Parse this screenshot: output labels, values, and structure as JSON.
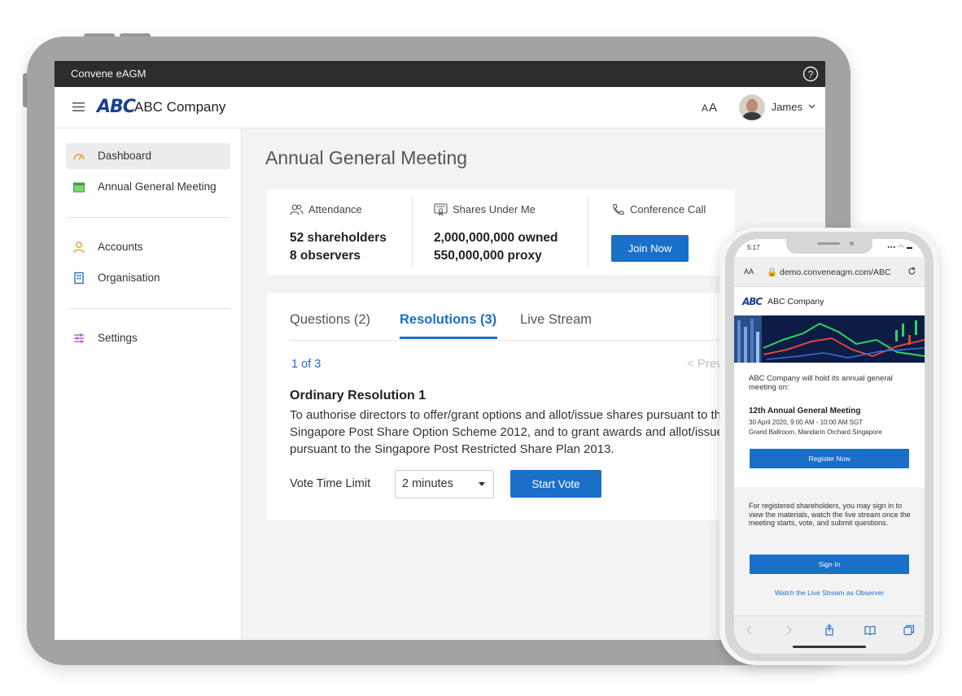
{
  "tablet": {
    "app_title": "Convene eAGM",
    "header": {
      "logo_text": "ABC",
      "company_name": "ABC Company",
      "font_toggle_small": "A",
      "font_toggle_large": "A",
      "user_name": "James"
    },
    "sidebar": {
      "items": [
        {
          "label": "Dashboard",
          "icon": "gauge-icon",
          "active": true
        },
        {
          "label": "Annual General Meeting",
          "icon": "calendar-icon"
        },
        {
          "label": "Accounts",
          "icon": "person-icon"
        },
        {
          "label": "Organisation",
          "icon": "building-icon"
        },
        {
          "label": "Settings",
          "icon": "sliders-icon"
        }
      ]
    },
    "main": {
      "page_title": "Annual General Meeting",
      "stats": {
        "attendance": {
          "label": "Attendance",
          "line1": "52 shareholders",
          "line2": "8 observers"
        },
        "shares": {
          "label": "Shares Under Me",
          "line1": "2,000,000,000 owned",
          "line2": "550,000,000 proxy"
        },
        "conference": {
          "label": "Conference Call",
          "button": "Join Now"
        }
      },
      "tabs": [
        {
          "label": "Questions (2)"
        },
        {
          "label": "Resolutions (3)",
          "active": true
        },
        {
          "label": "Live Stream"
        }
      ],
      "pager": "1 of 3",
      "prev": "< Prev",
      "resolution": {
        "title": "Ordinary Resolution 1",
        "line1": "To authorise directors to offer/grant options and allot/issue shares pursuant to the",
        "line2": "Singapore Post Share Option Scheme 2012, and to grant awards and allot/issue shares",
        "line3": "pursuant to the Singapore Post Restricted Share Plan 2013."
      },
      "vote": {
        "label": "Vote Time Limit",
        "selected": "2 minutes",
        "button": "Start Vote"
      }
    }
  },
  "phone": {
    "status_time": "5:17",
    "status_icons": "▪▪▪ ◠ ▬",
    "url_aa": "AA",
    "url": "🔒 demo.conveneagm.com/ABC",
    "logo_text": "ABC",
    "company_name": "ABC Company",
    "intro": "ABC Company will hold its annual general meeting on:",
    "event_title": "12th Annual General Meeting",
    "event_date": "30 April 2020, 9:00 AM - 10:00 AM SGT",
    "event_venue": "Grand Ballroom, Mandarin Orchard Singapore",
    "register_button": "Register Now",
    "info": "For registered shareholders, you may sign in to view the materials, watch the live stream once the meeting starts, vote, and submit questions.",
    "signin_button": "Sign In",
    "observer_link": "Watch the Live Stream as Observer"
  },
  "colors": {
    "accent": "#1a6fc8",
    "brand": "#1b3f8f",
    "titlebar": "#2d2d2d"
  }
}
